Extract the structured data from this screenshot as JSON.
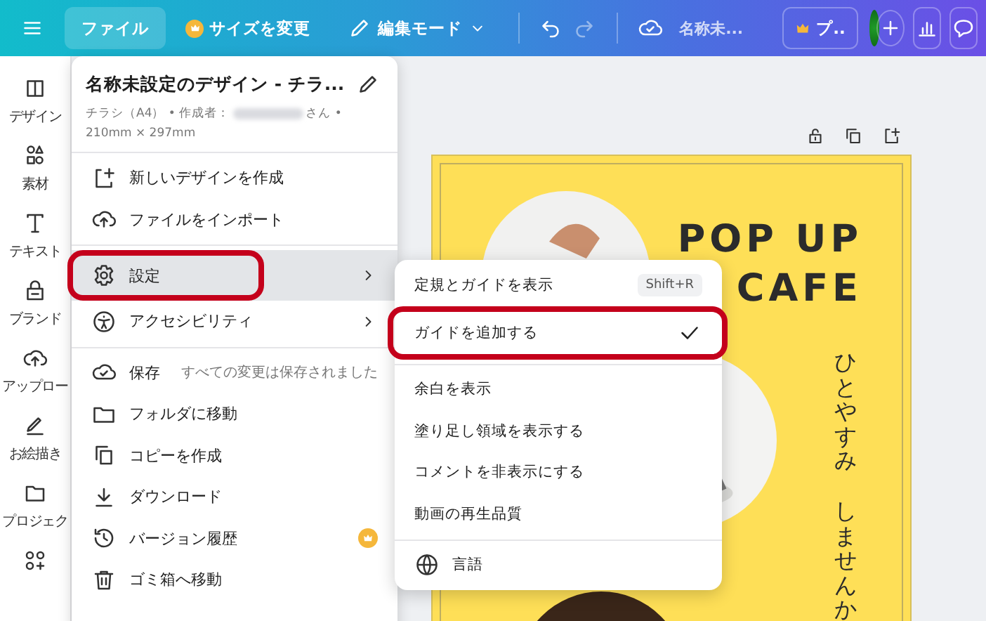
{
  "top_bar": {
    "file_button": {
      "label": "ファイル",
      "selected": true
    },
    "resize_button": "サイズを変更",
    "edit_mode": "編集モード",
    "document_title": "名称未...",
    "pro_button": "プ.."
  },
  "sidebar": {
    "items": [
      {
        "label": "デザイン"
      },
      {
        "label": "素材"
      },
      {
        "label": "テキスト"
      },
      {
        "label": "ブランド"
      },
      {
        "label": "アップロー"
      },
      {
        "label": "お絵描き"
      },
      {
        "label": "プロジェク"
      }
    ]
  },
  "file_menu": {
    "title": "名称未設定のデザイン - チラ...",
    "meta_prefix": "チラシ（A4） • 作成者：",
    "meta_suffix": "さん •",
    "size": "210mm × 297mm",
    "groups": [
      [
        {
          "label": "新しいデザインを作成"
        },
        {
          "label": "ファイルをインポート"
        }
      ],
      [
        {
          "label": "設定",
          "selected": true,
          "annotated": true,
          "submenu": true
        },
        {
          "label": "アクセシビリティ",
          "selected": false,
          "submenu": true
        }
      ],
      [
        {
          "label": "保存",
          "note": "すべての変更は保存されました"
        },
        {
          "label": "フォルダに移動"
        },
        {
          "label": "コピーを作成"
        },
        {
          "label": "ダウンロード"
        },
        {
          "label": "バージョン履歴",
          "premium": true
        },
        {
          "label": "ゴミ箱へ移動"
        }
      ]
    ]
  },
  "settings_submenu": {
    "groups": [
      [
        {
          "label": "定規とガイドを表示",
          "shortcut": "Shift+R"
        },
        {
          "label": "ガイドを追加する",
          "checked": true,
          "annotated": true
        }
      ],
      [
        {
          "label": "余白を表示"
        },
        {
          "label": "塗り足し領域を表示する"
        },
        {
          "label": "コメントを非表示にする"
        },
        {
          "label": "動画の再生品質"
        }
      ],
      [
        {
          "label": "言語",
          "globe": true
        }
      ]
    ]
  },
  "poster": {
    "headline": [
      "POP UP",
      "CAFE"
    ],
    "vertical_text": [
      "ひとやすみ",
      "しませんか"
    ]
  }
}
